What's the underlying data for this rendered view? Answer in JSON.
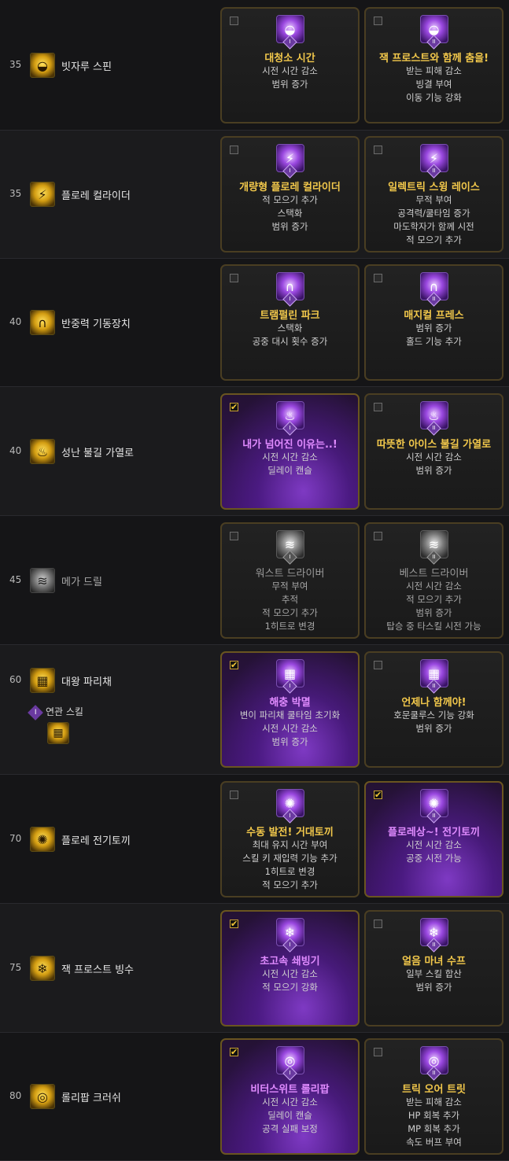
{
  "rows": [
    {
      "level": "35",
      "skill_name": "빗자루 스핀",
      "icon": "broom-spin-icon",
      "cards": [
        {
          "numeral": "I",
          "checked": false,
          "title": "대청소 시간",
          "desc": [
            "시전 시간 감소",
            "범위 증가"
          ],
          "icon": "broom-spin-icon"
        },
        {
          "numeral": "II",
          "checked": false,
          "title": "잭 프로스트와 함께 춤을!",
          "desc": [
            "받는 피해 감소",
            "빙결 부여",
            "이동 기능 강화"
          ],
          "icon": "broom-spin-icon"
        }
      ]
    },
    {
      "level": "35",
      "skill_name": "플로레 컬라이더",
      "icon": "collider-icon",
      "cards": [
        {
          "numeral": "I",
          "checked": false,
          "title": "개량형 플로레 컬라이더",
          "desc": [
            "적 모으기 추가",
            "스택화",
            "범위 증가"
          ],
          "icon": "collider-icon"
        },
        {
          "numeral": "II",
          "checked": false,
          "title": "일렉트릭 스윙 레이스",
          "desc": [
            "무적 부여",
            "공격력/쿨타임 증가",
            "마도학자가 함께 시전",
            "적 모으기 추가"
          ],
          "icon": "collider-icon"
        }
      ]
    },
    {
      "level": "40",
      "skill_name": "반중력 기동장치",
      "icon": "anti-gravity-icon",
      "cards": [
        {
          "numeral": "I",
          "checked": false,
          "title": "트램펄린 파크",
          "desc": [
            "스택화",
            "공중 대시 횟수 증가"
          ],
          "icon": "anti-gravity-icon"
        },
        {
          "numeral": "II",
          "checked": false,
          "title": "매지컬 프레스",
          "desc": [
            "범위 증가",
            "홀드 기능 추가"
          ],
          "icon": "anti-gravity-icon"
        }
      ]
    },
    {
      "level": "40",
      "skill_name": "성난 불길 가열로",
      "icon": "furnace-icon",
      "cards": [
        {
          "numeral": "I",
          "checked": true,
          "title": "내가 넘어진 이유는..!",
          "desc": [
            "시전 시간 감소",
            "딜레이 캔슬"
          ],
          "icon": "furnace-icon"
        },
        {
          "numeral": "II",
          "checked": false,
          "title": "따뜻한 아이스 불길 가열로",
          "desc": [
            "시전 시간 감소",
            "범위 증가"
          ],
          "icon": "furnace-icon"
        }
      ]
    },
    {
      "level": "45",
      "skill_name": "메가 드릴",
      "icon": "mega-drill-icon",
      "cards": [
        {
          "numeral": "I",
          "checked": false,
          "title": "워스트 드라이버",
          "desc": [
            "무적 부여",
            "추적",
            "적 모으기 추가",
            "1히트로 변경"
          ],
          "icon": "mega-drill-icon"
        },
        {
          "numeral": "II",
          "checked": false,
          "title": "베스트 드라이버",
          "desc": [
            "시전 시간 감소",
            "적 모으기 추가",
            "범위 증가",
            "탑승 중 타스킬 시전 가능"
          ],
          "icon": "mega-drill-icon"
        }
      ]
    },
    {
      "level": "60",
      "skill_name": "대왕 파리채",
      "icon": "fly-swatter-icon",
      "related_label": "연관 스킬",
      "related_numeral": "I",
      "cards": [
        {
          "numeral": "I",
          "checked": true,
          "title": "해충 박멸",
          "desc": [
            "변이 파리채 쿨타임 초기화",
            "시전 시간 감소",
            "범위 증가"
          ],
          "icon": "fly-swatter-icon"
        },
        {
          "numeral": "II",
          "checked": false,
          "title": "언제나 함께야!",
          "desc": [
            "호문쿨루스 기능 강화",
            "범위 증가"
          ],
          "icon": "fly-swatter-icon"
        }
      ]
    },
    {
      "level": "70",
      "skill_name": "플로레 전기토끼",
      "icon": "electric-rabbit-icon",
      "cards": [
        {
          "numeral": "I",
          "checked": false,
          "title": "수동 발전! 거대토끼",
          "desc": [
            "최대 유지 시간 부여",
            "스킬 키 재입력 기능 추가",
            "1히트로 변경",
            "적 모으기 추가"
          ],
          "icon": "electric-rabbit-icon"
        },
        {
          "numeral": "II",
          "checked": true,
          "title": "플로레상~! 전기토끼",
          "desc": [
            "시전 시간 감소",
            "공중 시전 가능"
          ],
          "icon": "electric-rabbit-icon"
        }
      ]
    },
    {
      "level": "75",
      "skill_name": "잭 프로스트 빙수",
      "icon": "shaved-ice-icon",
      "cards": [
        {
          "numeral": "I",
          "checked": true,
          "title": "초고속 쇄빙기",
          "desc": [
            "시전 시간 감소",
            "적 모으기 강화"
          ],
          "icon": "shaved-ice-icon"
        },
        {
          "numeral": "II",
          "checked": false,
          "title": "얼음 마녀 수프",
          "desc": [
            "일부 스킬 합산",
            "범위 증가"
          ],
          "icon": "shaved-ice-icon"
        }
      ]
    },
    {
      "level": "80",
      "skill_name": "롤리팝 크러쉬",
      "icon": "lollipop-icon",
      "cards": [
        {
          "numeral": "I",
          "checked": true,
          "title": "비터스위트 롤리팝",
          "desc": [
            "시전 시간 감소",
            "딜레이 캔슬",
            "공격 실패 보정"
          ],
          "icon": "lollipop-icon"
        },
        {
          "numeral": "II",
          "checked": false,
          "title": "트릭 오어 트릿",
          "desc": [
            "받는 피해 감소",
            "HP 회복 추가",
            "MP 회복 추가",
            "속도 버프 부여"
          ],
          "icon": "lollipop-icon"
        }
      ]
    }
  ],
  "colors": {
    "gold": "#f2c84b",
    "purple_title": "#e08bff",
    "card_border": "#4a3e22",
    "row_bg": "#151517"
  }
}
